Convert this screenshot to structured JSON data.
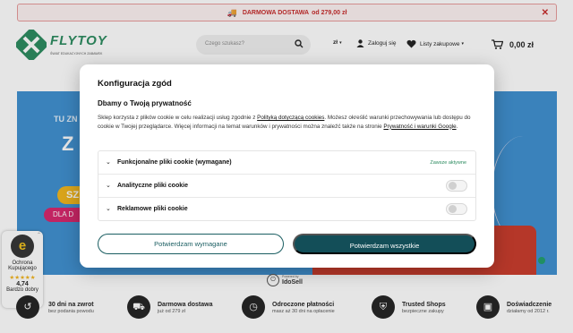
{
  "promo": {
    "icon": "truck-icon",
    "text": "DARMOWA DOSTAWA",
    "amount": "od 279,00 zł"
  },
  "header": {
    "brand": "FLYTOY",
    "tagline": "ŚWIAT EDUKACYJNYCH ZABAWEK",
    "search_placeholder": "Czego szukasz?",
    "currency": "zł",
    "login": "Zaloguj się",
    "wishlist": "Listy zakupowe",
    "cart_value": "0,00 zł"
  },
  "hero": {
    "line1": "TU ZN",
    "line2": "Z",
    "pill1": "SZ",
    "pill2": "DLA D"
  },
  "powered": {
    "label": "Powered by",
    "name": "IdoSell"
  },
  "trust_badge": {
    "line1": "Ochrona",
    "line2": "Kupującego",
    "stars": "★★★★★",
    "score": "4,74",
    "quality": "Bardzo dobry"
  },
  "features": [
    {
      "title": "30 dni na zwrot",
      "sub": "bez podania powodu"
    },
    {
      "title": "Darmowa dostawa",
      "sub": "już od 279 zł"
    },
    {
      "title": "Odroczone płatności",
      "sub": "masz aż 30 dni na opłacenie"
    },
    {
      "title": "Trusted Shops",
      "sub": "bezpieczne zakupy"
    },
    {
      "title": "Doświadczenie",
      "sub": "działamy od 2012 r."
    }
  ],
  "modal": {
    "title": "Konfiguracja zgód",
    "subtitle": "Dbamy o Twoją prywatność",
    "desc_1": "Sklep korzysta z plików cookie w celu realizacji usług zgodnie z ",
    "policy_link": "Polityką dotyczącą cookies",
    "desc_2": ". Możesz określić warunki przechowywania lub dostępu do cookie w Twojej przeglądarce. Więcej informacji na temat warunków i prywatności można znaleźć także na stronie ",
    "privacy_link": "Prywatność i warunki Google",
    "desc_3": ".",
    "rows": [
      {
        "label": "Funkcjonalne pliki cookie (wymagane)",
        "status": "Zawsze aktywne"
      },
      {
        "label": "Analityczne pliki cookie"
      },
      {
        "label": "Reklamowe pliki cookie"
      }
    ],
    "btn_required": "Potwierdzam wymagane",
    "btn_all": "Potwierdzam wszystkie"
  }
}
